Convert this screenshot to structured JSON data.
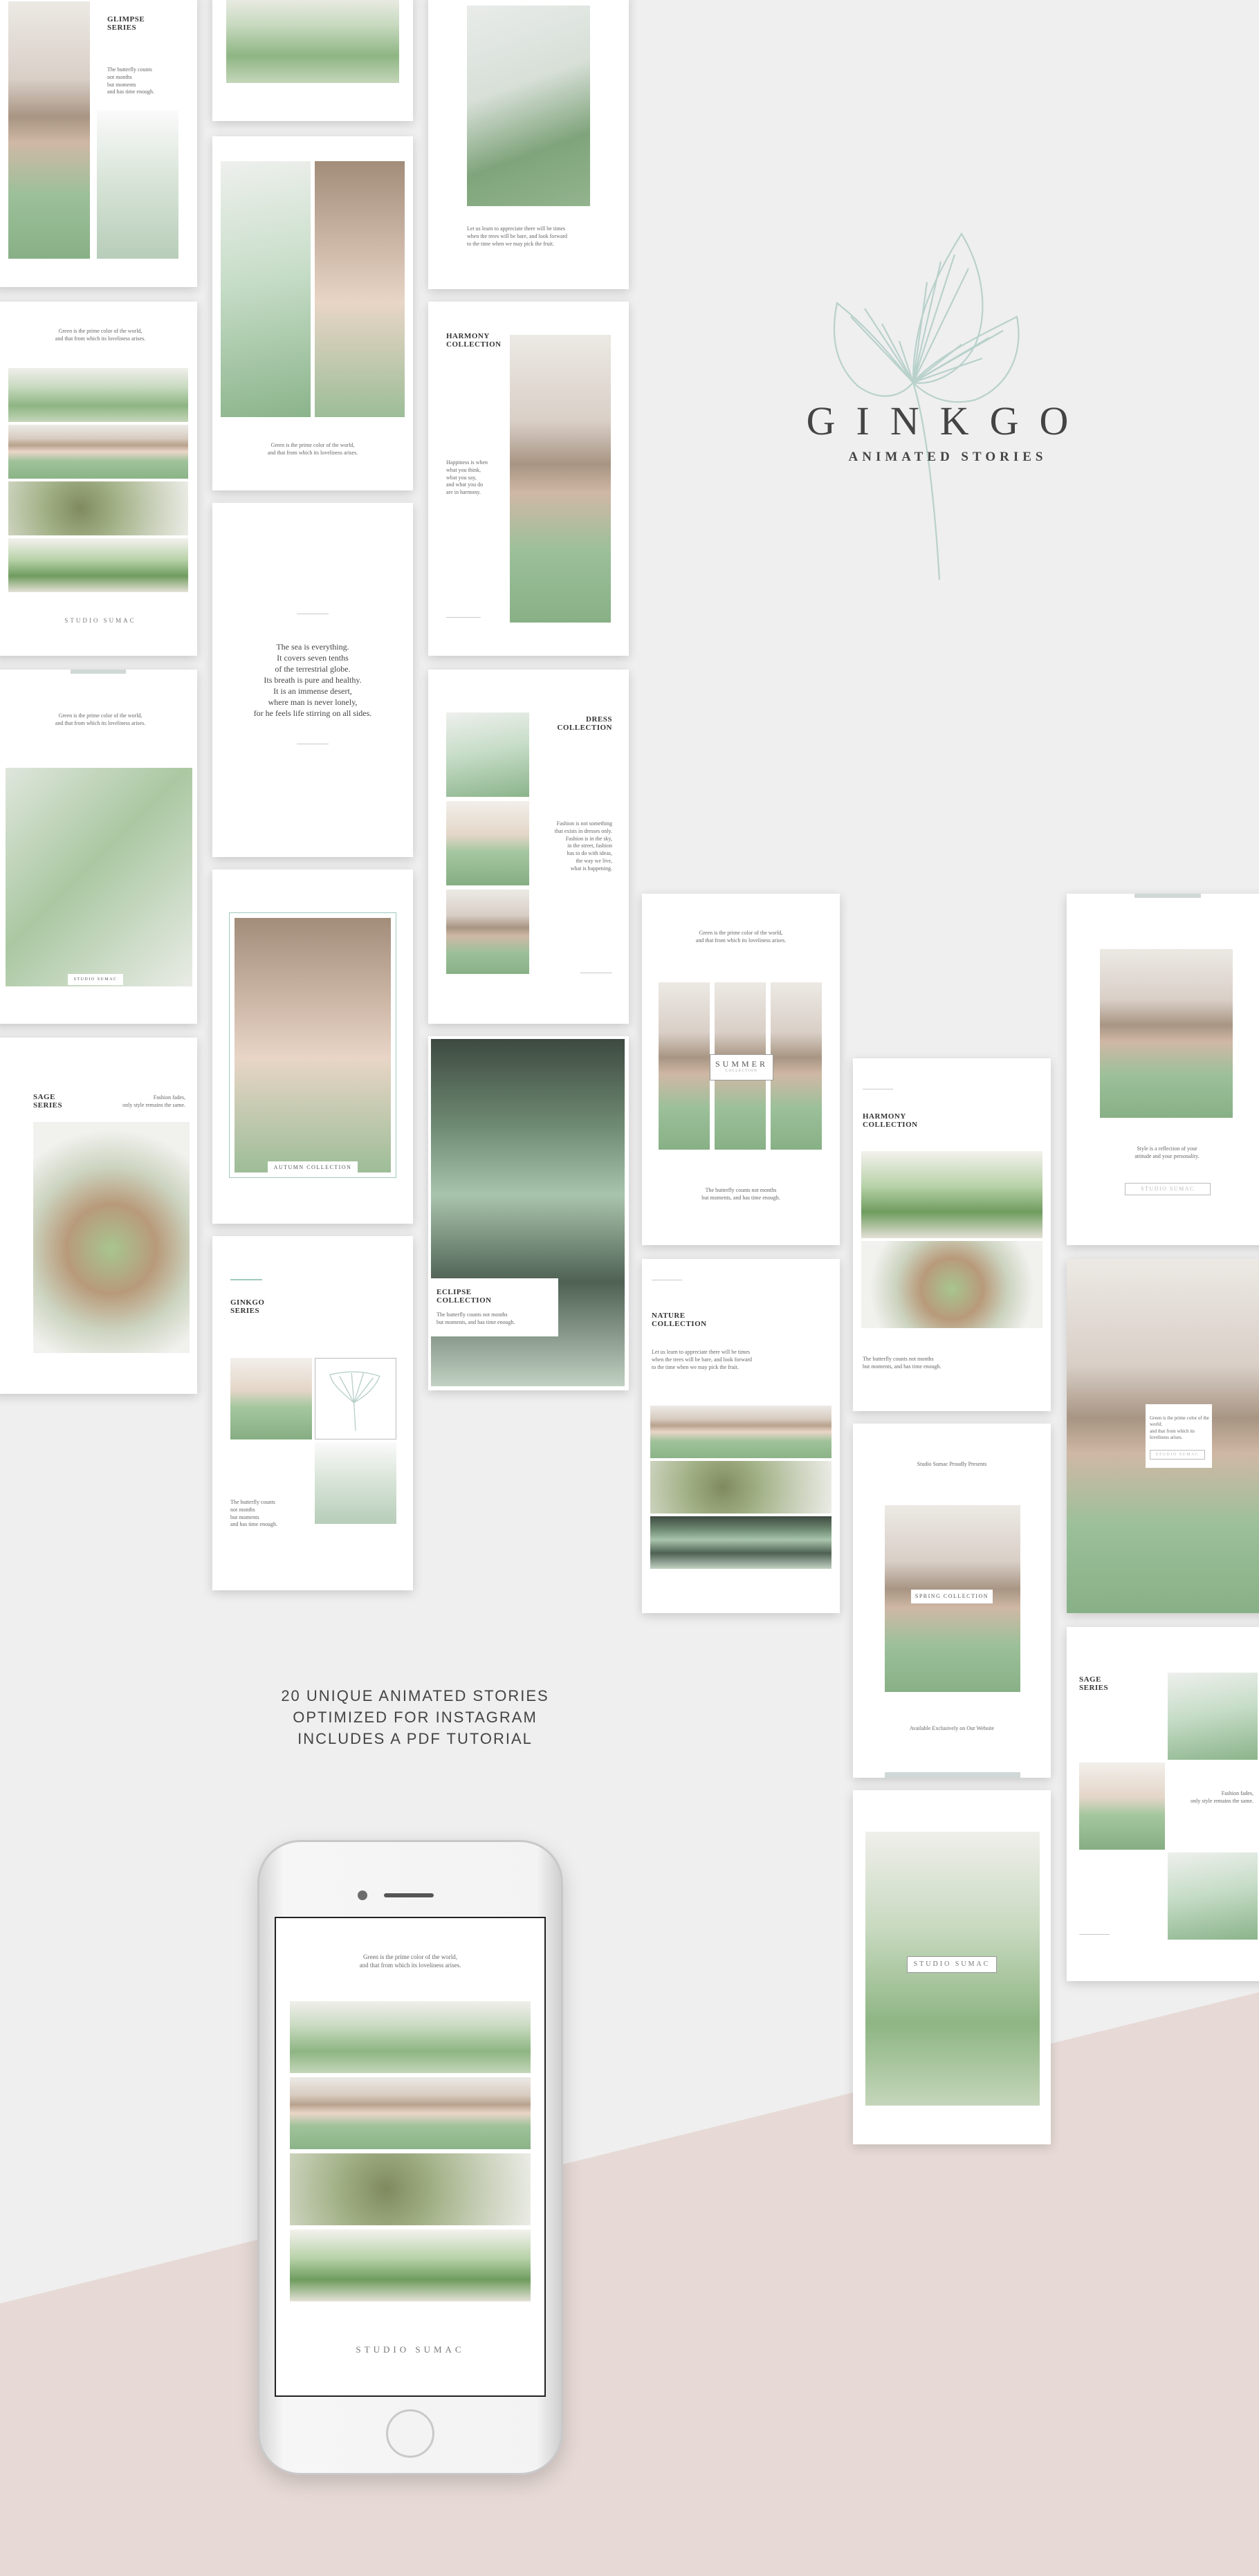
{
  "brand": {
    "title": "GINKGO",
    "subtitle": "ANIMATED STORIES",
    "logo_icon": "ginkgo-leaf-icon",
    "accent": "#b9d1cb"
  },
  "features": [
    "20 UNIQUE ANIMATED STORIES",
    "OPTIMIZED FOR INSTAGRAM",
    "INCLUDES A PDF TUTORIAL"
  ],
  "quote_green": "Green is the prime color of the world,\nand that from which its loveliness arises.",
  "quote_green_short": "Green is the prime color of the world,\nand that from which its loveliness arises.",
  "butterfly": "The butterfly counts not months\nbut moments, and has time enough.",
  "butterfly_short": "The butterfly counts\nnot months\nbut moments\nand has time enough.",
  "sea_quote": [
    "The sea is everything.",
    "It covers seven tenths",
    "of the terrestrial globe.",
    "Its breath is pure and healthy.",
    "It is an immense desert,",
    "where man is never lonely,",
    "for he feels life stirring on all sides."
  ],
  "learn": "Let us learn to appreciate there will be times\nwhen the trees will be bare, and look forward\nto the time when we may pick the fruit.",
  "happiness": "Happiness is when\nwhat you think,\nwhat you say,\nand what you do\nare in harmony.",
  "fashion_quote": "Fashion is not something\nthat exists in dresses only.\nFashion is in the sky,\nin the street, fashion\nhas to do with ideas,\nthe way we live,\nwhat is happening.",
  "fashion_fades": "Fashion fades,\nonly style remains the same.",
  "style_quote": "Style is a reflection of your\nattitude and your personality.",
  "studio": "STUDIO SUMAC",
  "studio_presents": "Studio Sumac Proudly Presents",
  "available": "Available Exclusively on Our Website",
  "titles": {
    "glimpse": "GLIMPSE\nSERIES",
    "harmony": "HARMONY\nCOLLECTION",
    "dress": "DRESS\nCOLLECTION",
    "sage": "SAGE\nSERIES",
    "ginkgo": "GINKGO\nSERIES",
    "eclipse": "ECLIPSE\nCOLLECTION",
    "nature": "NATURE\nCOLLECTION"
  },
  "tags": {
    "autumn": "AUTUMN COLLECTION",
    "summer": "SUMMER",
    "summer_sub": "COLLECTION",
    "spring": "SPRING COLLECTION",
    "studio_sumac": "STUDIO SUMAC"
  }
}
